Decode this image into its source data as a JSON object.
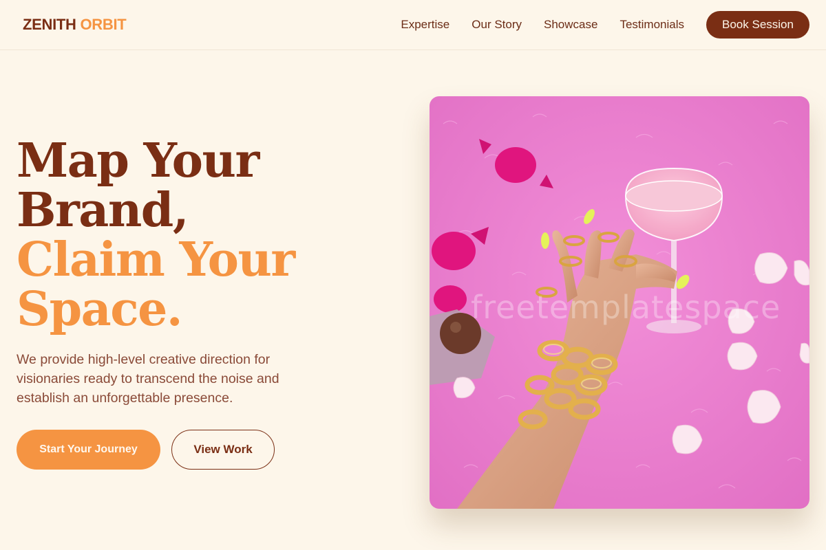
{
  "brand": {
    "part1": "ZENITH",
    "part2": "ORBIT"
  },
  "nav": {
    "links": [
      "Expertise",
      "Our Story",
      "Showcase",
      "Testimonials"
    ],
    "cta": "Book Session"
  },
  "hero": {
    "line1": "Map Your",
    "line2": "Brand,",
    "line3": "Claim Your",
    "line4": "Space.",
    "description": "We provide high-level creative direction for visionaries ready to transcend the noise and establish an unforgettable presence.",
    "primary_button": "Start Your Journey",
    "secondary_button": "View Work",
    "image_watermark": "freetemplatespace"
  },
  "colors": {
    "brand_dark": "#7a2e14",
    "accent": "#f59442",
    "background": "#fdf6ea",
    "body_text": "#8a4a38"
  }
}
